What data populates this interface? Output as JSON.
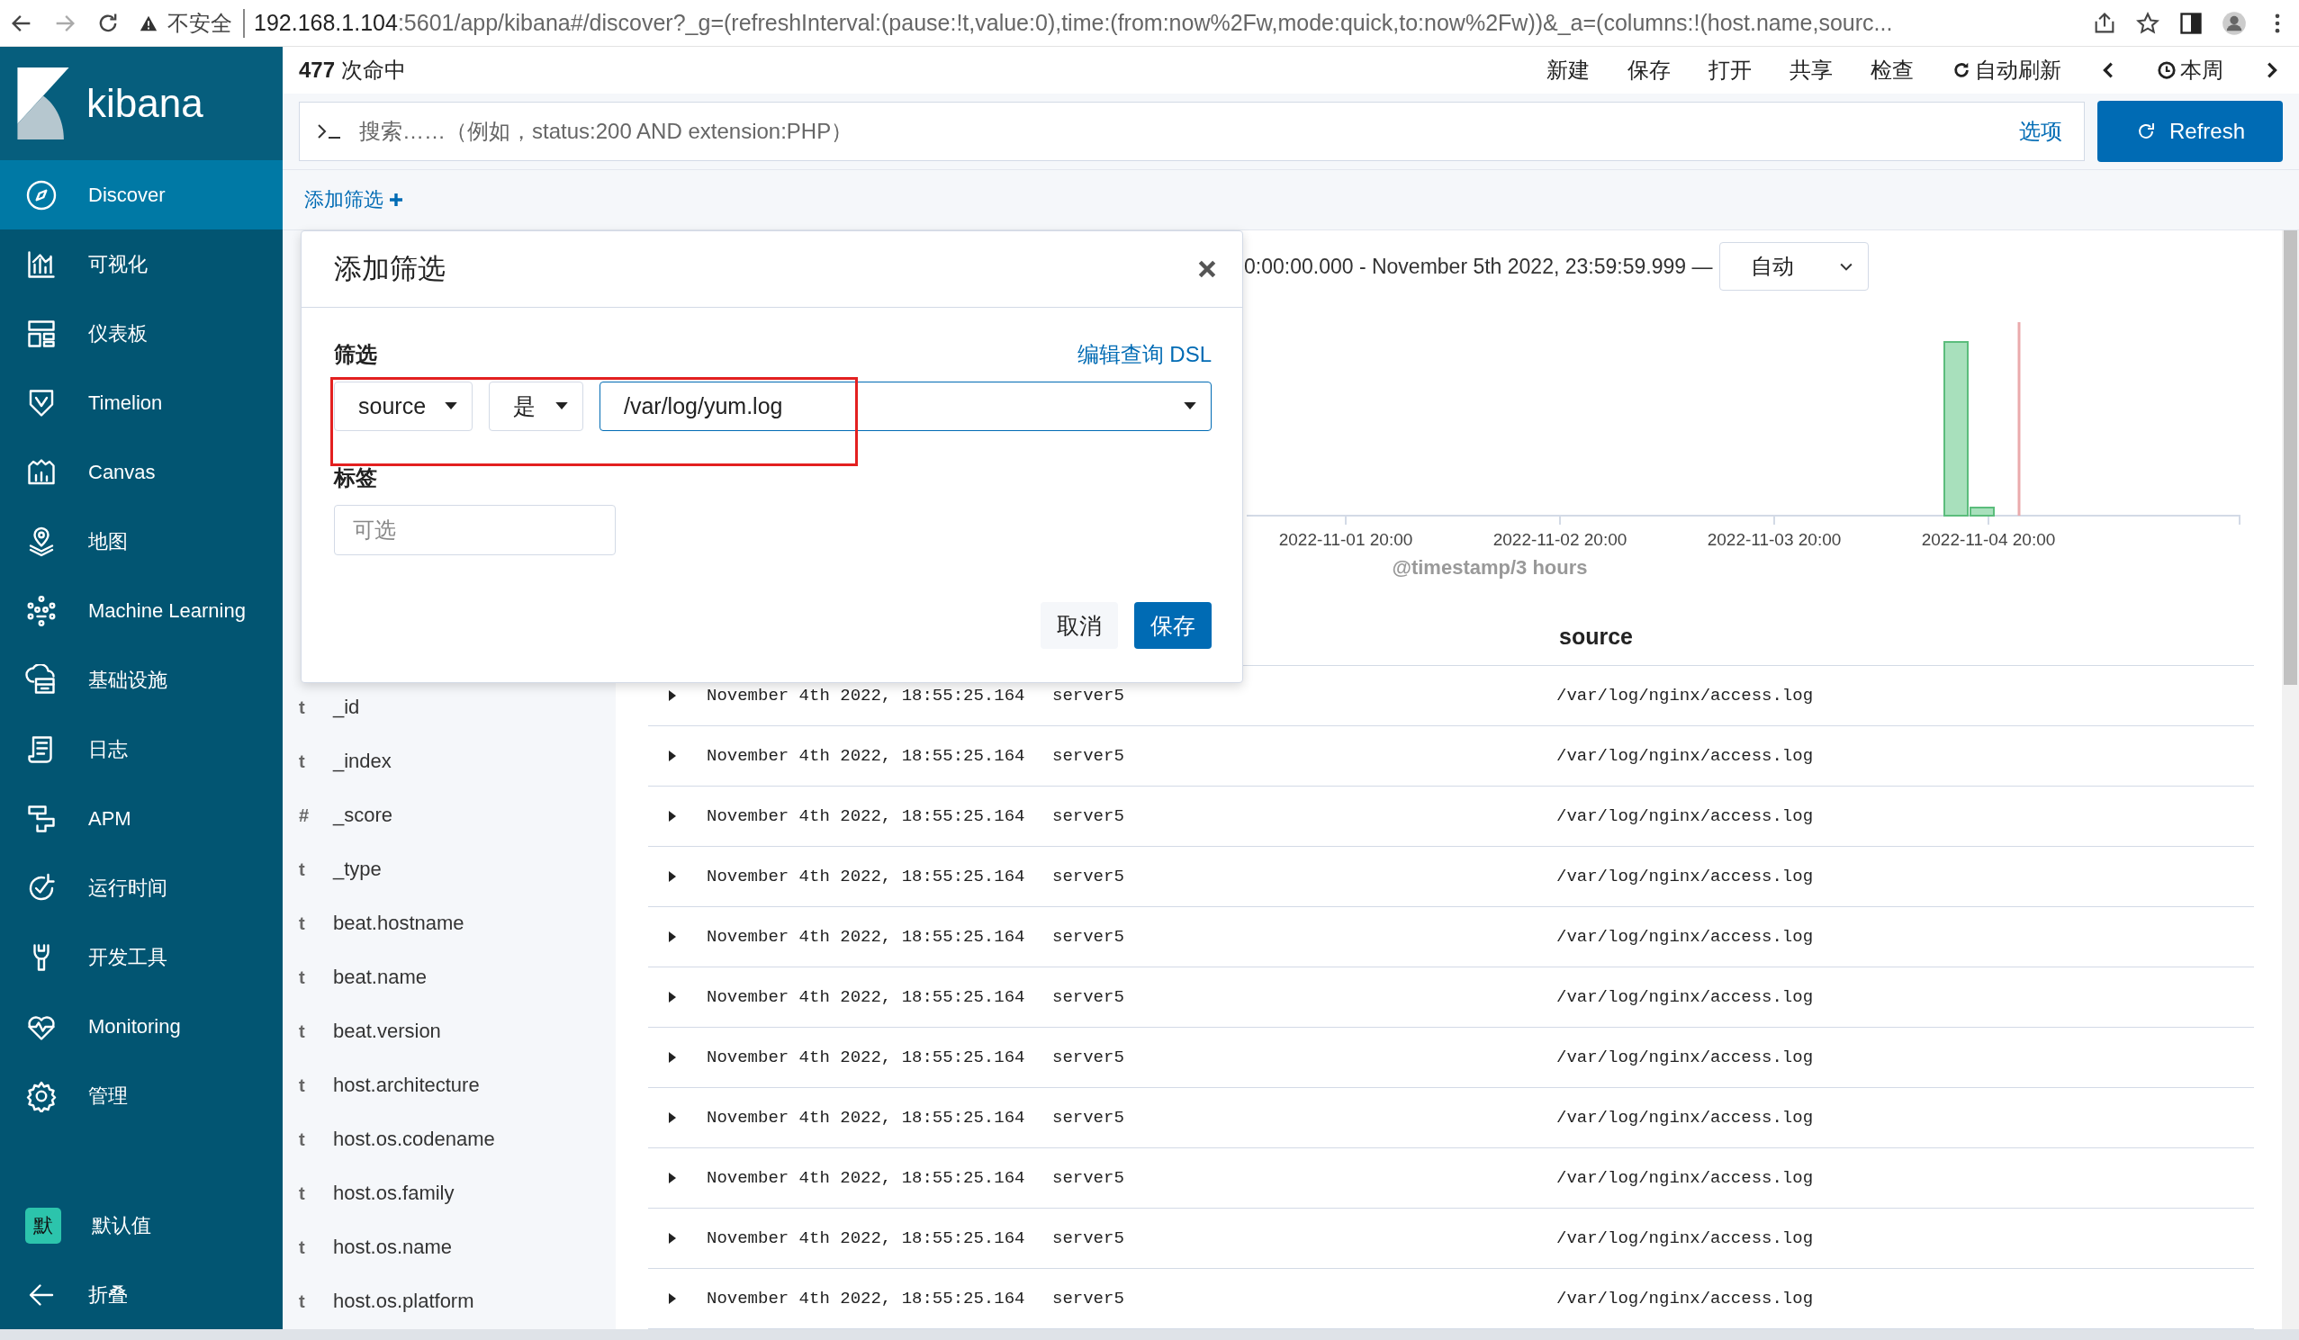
{
  "browser": {
    "security_label": "不安全",
    "url_host": "192.168.1.104",
    "url_rest": ":5601/app/kibana#/discover?_g=(refreshInterval:(pause:!t,value:0),time:(from:now%2Fw,mode:quick,to:now%2Fw))&_a=(columns:!(host.name,sourc..."
  },
  "sidebar": {
    "logo_text": "kibana",
    "items": [
      {
        "label": "Discover",
        "selected": true
      },
      {
        "label": "可视化",
        "selected": false
      },
      {
        "label": "仪表板",
        "selected": false
      },
      {
        "label": "Timelion",
        "selected": false
      },
      {
        "label": "Canvas",
        "selected": false
      },
      {
        "label": "地图",
        "selected": false
      },
      {
        "label": "Machine Learning",
        "selected": false
      },
      {
        "label": "基础设施",
        "selected": false
      },
      {
        "label": "日志",
        "selected": false
      },
      {
        "label": "APM",
        "selected": false
      },
      {
        "label": "运行时间",
        "selected": false
      },
      {
        "label": "开发工具",
        "selected": false
      },
      {
        "label": "Monitoring",
        "selected": false
      },
      {
        "label": "管理",
        "selected": false
      }
    ],
    "space": {
      "badge": "默",
      "label": "默认值"
    },
    "collapse": {
      "label": "折叠"
    }
  },
  "topbar": {
    "hits_count": "477",
    "hits_label": "次命中",
    "menu": [
      "新建",
      "保存",
      "打开",
      "共享",
      "检查"
    ],
    "auto_refresh": "自动刷新",
    "time_picker": "本周"
  },
  "search": {
    "placeholder": "搜索……（例如，status:200 AND extension:PHP）",
    "options_link": "选项",
    "refresh_button": "Refresh"
  },
  "add_filter_link": "添加筛选",
  "modal": {
    "title": "添加筛选",
    "filter_label": "筛选",
    "dsl_link": "编辑查询 DSL",
    "field": "source",
    "operator": "是",
    "value": "/var/log/yum.log",
    "tags_label": "标签",
    "tags_placeholder": "可选",
    "cancel_button": "取消",
    "save_button": "保存"
  },
  "fields": [
    {
      "type": "t",
      "name": "_id"
    },
    {
      "type": "t",
      "name": "_index"
    },
    {
      "type": "#",
      "name": "_score"
    },
    {
      "type": "t",
      "name": "_type"
    },
    {
      "type": "t",
      "name": "beat.hostname"
    },
    {
      "type": "t",
      "name": "beat.name"
    },
    {
      "type": "t",
      "name": "beat.version"
    },
    {
      "type": "t",
      "name": "host.architecture"
    },
    {
      "type": "t",
      "name": "host.os.codename"
    },
    {
      "type": "t",
      "name": "host.os.family"
    },
    {
      "type": "t",
      "name": "host.os.name"
    },
    {
      "type": "t",
      "name": "host.os.platform"
    }
  ],
  "histogram": {
    "time_range": "0:00:00.000 - November 5th 2022, 23:59:59.999 —",
    "interval": "自动",
    "x_tick_labels": [
      "2022-11-01 20:00",
      "2022-11-02 20:00",
      "2022-11-03 20:00",
      "2022-11-04 20:00"
    ],
    "xlabel": "@timestamp/3 hours"
  },
  "table": {
    "source_header": "source",
    "rows": [
      {
        "time": "November 4th 2022, 18:55:25.164",
        "host": "server5",
        "source": "/var/log/nginx/access.log"
      },
      {
        "time": "November 4th 2022, 18:55:25.164",
        "host": "server5",
        "source": "/var/log/nginx/access.log"
      },
      {
        "time": "November 4th 2022, 18:55:25.164",
        "host": "server5",
        "source": "/var/log/nginx/access.log"
      },
      {
        "time": "November 4th 2022, 18:55:25.164",
        "host": "server5",
        "source": "/var/log/nginx/access.log"
      },
      {
        "time": "November 4th 2022, 18:55:25.164",
        "host": "server5",
        "source": "/var/log/nginx/access.log"
      },
      {
        "time": "November 4th 2022, 18:55:25.164",
        "host": "server5",
        "source": "/var/log/nginx/access.log"
      },
      {
        "time": "November 4th 2022, 18:55:25.164",
        "host": "server5",
        "source": "/var/log/nginx/access.log"
      },
      {
        "time": "November 4th 2022, 18:55:25.164",
        "host": "server5",
        "source": "/var/log/nginx/access.log"
      },
      {
        "time": "November 4th 2022, 18:55:25.164",
        "host": "server5",
        "source": "/var/log/nginx/access.log"
      },
      {
        "time": "November 4th 2022, 18:55:25.164",
        "host": "server5",
        "source": "/var/log/nginx/access.log"
      },
      {
        "time": "November 4th 2022, 18:55:25.164",
        "host": "server5",
        "source": "/var/log/nginx/access.log"
      }
    ]
  }
}
